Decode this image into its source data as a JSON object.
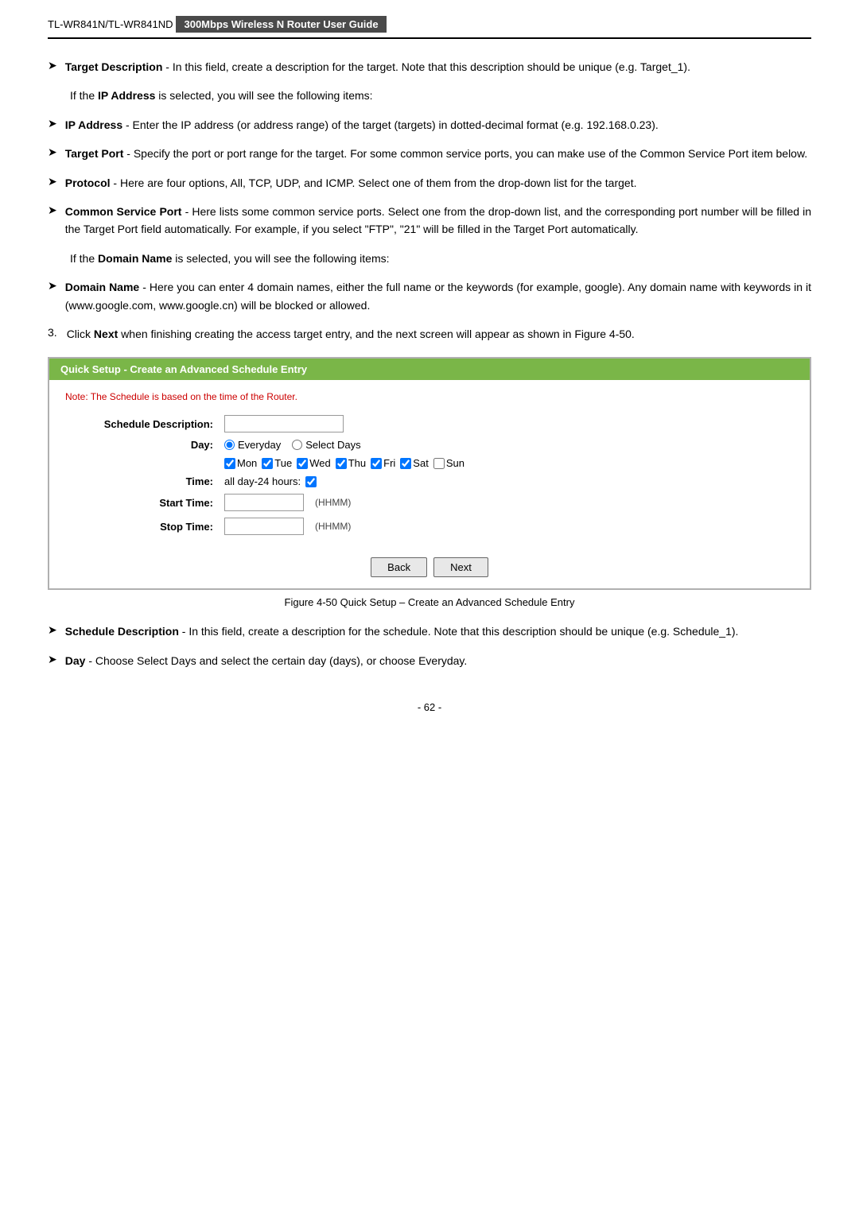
{
  "header": {
    "left": "TL-WR841N/TL-WR841ND",
    "right": "300Mbps Wireless N Router User Guide"
  },
  "bullets_section1": [
    {
      "bold_part": "Target Description",
      "rest": " - In this field, create a description for the target. Note that this description should be unique (e.g. Target_1)."
    }
  ],
  "para_ip": "If the IP Address is selected, you will see the following items:",
  "para_ip_bold": "IP Address",
  "bullets_ip": [
    {
      "bold_part": "IP Address",
      "rest": " - Enter the IP address (or address range) of the target (targets) in dotted-decimal format (e.g. 192.168.0.23)."
    },
    {
      "bold_part": "Target Port",
      "rest": " - Specify the port or port range for the target. For some common service ports, you can make use of the Common Service Port item below."
    },
    {
      "bold_part": "Protocol",
      "rest": " - Here are four options, All, TCP, UDP, and ICMP. Select one of them from the drop-down list for the target."
    },
    {
      "bold_part": "Common Service Port",
      "rest": " - Here lists some common service ports. Select one from the drop-down list, and the corresponding port number will be filled in the Target Port field automatically. For example, if you select \"FTP\", \"21\" will be filled in the Target Port automatically."
    }
  ],
  "para_domain": "If the Domain Name is selected, you will see the following items:",
  "para_domain_bold": "Domain Name",
  "bullets_domain": [
    {
      "bold_part": "Domain Name",
      "rest": " - Here you can enter 4 domain names, either the full name or the keywords (for example, google). Any domain name with keywords in it (www.google.com, www.google.cn) will be blocked or allowed."
    }
  ],
  "numbered_item": {
    "number": "3.",
    "text_before_bold": "Click ",
    "bold_part": "Next",
    "text_after": " when finishing creating the access target entry, and the next screen will appear as shown in Figure 4-50."
  },
  "schedule_box": {
    "header": "Quick Setup - Create an Advanced Schedule Entry",
    "note": "Note: The Schedule is based on the time of the Router.",
    "fields": {
      "description_label": "Schedule Description:",
      "day_label": "Day:",
      "time_label": "Time:",
      "start_time_label": "Start Time:",
      "stop_time_label": "Stop Time:"
    },
    "radio_everyday": "Everyday",
    "radio_select_days": "Select Days",
    "days": [
      "Mon",
      "Tue",
      "Wed",
      "Thu",
      "Fri",
      "Sat",
      "Sun"
    ],
    "all_day_label": "all day-24 hours:",
    "hhmm": "(HHMM)",
    "back_btn": "Back",
    "next_btn": "Next"
  },
  "figure_caption": "Figure 4-50   Quick Setup – Create an Advanced Schedule Entry",
  "bullets_after": [
    {
      "bold_part": "Schedule Description",
      "rest": " - In this field, create a description for the schedule. Note that this description should be unique (e.g. Schedule_1)."
    },
    {
      "bold_part": "Day",
      "rest": " - Choose Select Days and select the certain day (days), or choose Everyday."
    }
  ],
  "page_number": "- 62 -"
}
